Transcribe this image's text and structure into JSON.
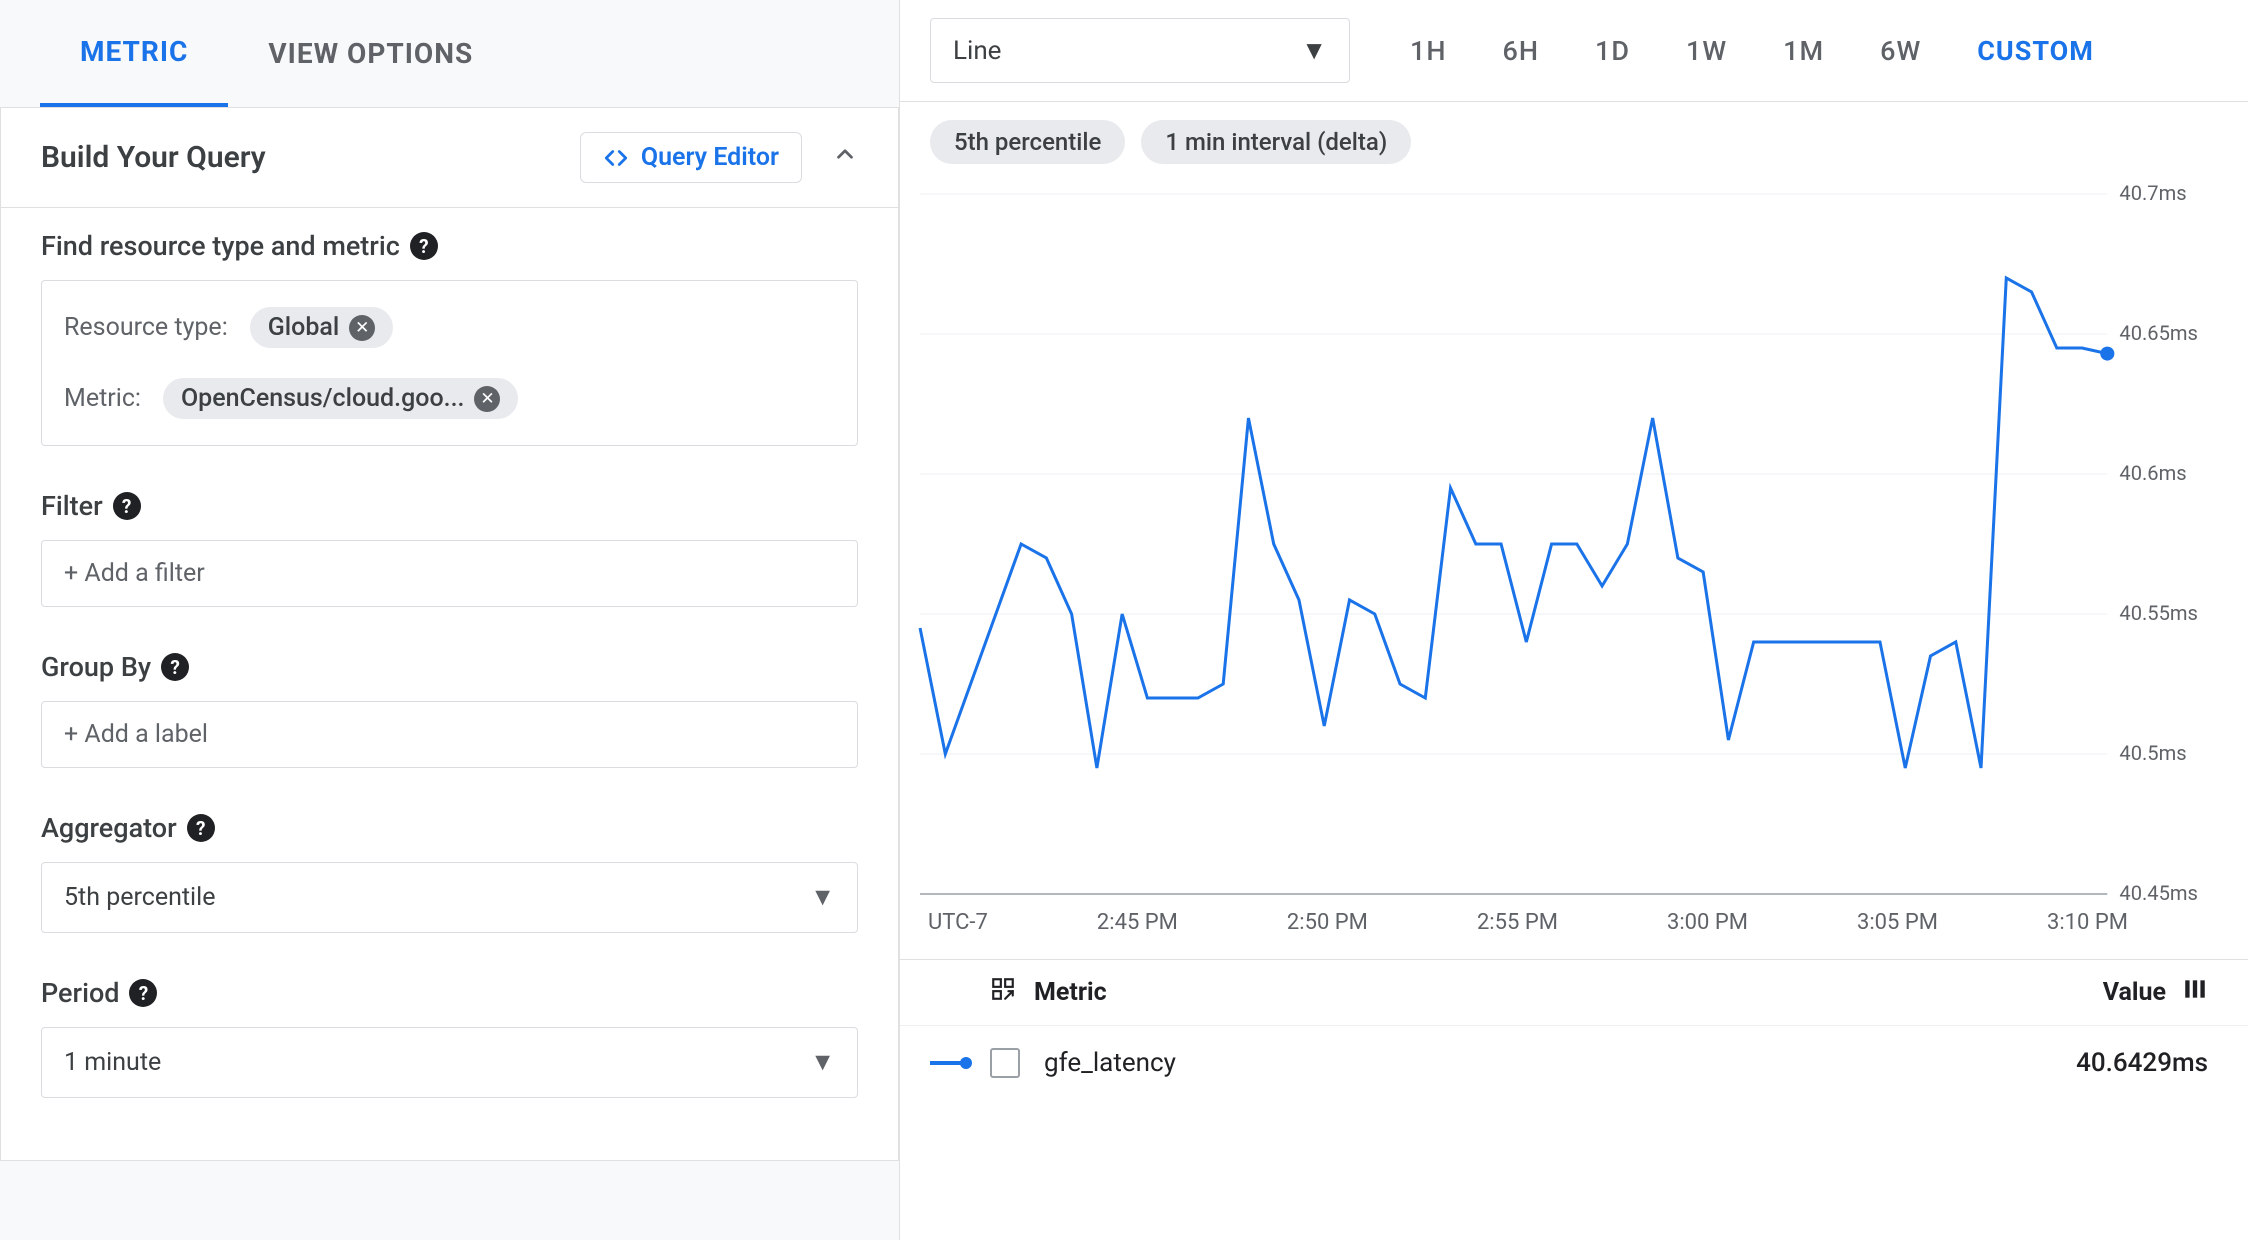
{
  "tabs": {
    "metric": "METRIC",
    "view_options": "VIEW OPTIONS"
  },
  "panel": {
    "title": "Build Your Query",
    "query_editor": "Query Editor"
  },
  "find": {
    "label": "Find resource type and metric",
    "resource_type_label": "Resource type:",
    "resource_type_value": "Global",
    "metric_label": "Metric:",
    "metric_value": "OpenCensus/cloud.goo..."
  },
  "filter": {
    "label": "Filter",
    "placeholder": "+ Add a filter"
  },
  "groupby": {
    "label": "Group By",
    "placeholder": "+ Add a label"
  },
  "aggregator": {
    "label": "Aggregator",
    "value": "5th percentile"
  },
  "period": {
    "label": "Period",
    "value": "1 minute"
  },
  "chart_type": "Line",
  "ranges": [
    "1H",
    "6H",
    "1D",
    "1W",
    "1M",
    "6W",
    "CUSTOM"
  ],
  "active_range": "CUSTOM",
  "chips": [
    "5th percentile",
    "1 min interval (delta)"
  ],
  "legend": {
    "metric_header": "Metric",
    "value_header": "Value",
    "series_name": "gfe_latency",
    "series_value": "40.6429ms"
  },
  "chart_data": {
    "type": "line",
    "title": "",
    "xlabel": "UTC-7",
    "ylabel": "",
    "y_ticks": [
      "40.7ms",
      "40.65ms",
      "40.6ms",
      "40.55ms",
      "40.5ms",
      "40.45ms"
    ],
    "ylim": [
      40.45,
      40.7
    ],
    "x_ticks": [
      "UTC-7",
      "2:45 PM",
      "2:50 PM",
      "2:55 PM",
      "3:00 PM",
      "3:05 PM",
      "3:10 PM"
    ],
    "series": [
      {
        "name": "gfe_latency",
        "color": "#1a73e8",
        "y": [
          40.545,
          40.5,
          40.525,
          40.55,
          40.575,
          40.57,
          40.55,
          40.495,
          40.55,
          40.52,
          40.52,
          40.52,
          40.525,
          40.62,
          40.575,
          40.555,
          40.51,
          40.555,
          40.55,
          40.525,
          40.52,
          40.595,
          40.575,
          40.575,
          40.54,
          40.575,
          40.575,
          40.56,
          40.575,
          40.62,
          40.57,
          40.565,
          40.505,
          40.54,
          40.54,
          40.54,
          40.54,
          40.54,
          40.54,
          40.495,
          40.535,
          40.54,
          40.495,
          40.67,
          40.665,
          40.645,
          40.645,
          40.643
        ]
      }
    ]
  }
}
